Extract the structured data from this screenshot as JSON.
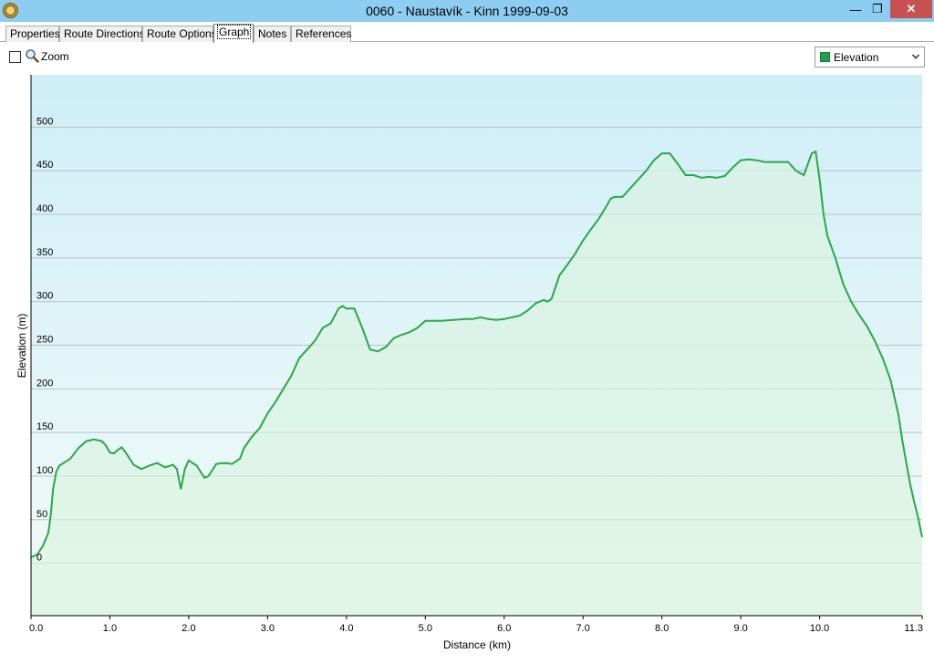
{
  "window": {
    "title": "0060 - Naustavík - Kinn 1999-09-03",
    "controls": {
      "minimize": "—",
      "maximize": "❐",
      "close": "✕"
    }
  },
  "tabs": [
    {
      "label": "Properties"
    },
    {
      "label": "Route Directions"
    },
    {
      "label": "Route Options"
    },
    {
      "label": "Graph",
      "active": true
    },
    {
      "label": "Notes"
    },
    {
      "label": "References"
    }
  ],
  "toolbar": {
    "zoom_label": "Zoom",
    "zoom_checked": false,
    "series_selector": {
      "selected": "Elevation",
      "swatch_color": "#1fa04a"
    }
  },
  "icons": {
    "app": "gps-app-icon",
    "zoom": "magnifier-icon",
    "dropdown": "chevron-down-icon"
  },
  "chart_data": {
    "type": "area",
    "xlabel": "Distance  (km)",
    "ylabel": "Elevation (m)",
    "xlim": [
      0,
      11.3
    ],
    "ylim": [
      -60,
      560
    ],
    "x_ticks": [
      "0.0",
      "1.0",
      "2.0",
      "3.0",
      "4.0",
      "5.0",
      "6.0",
      "7.0",
      "8.0",
      "9.0",
      "10.0",
      "11.3"
    ],
    "x_tick_values": [
      0,
      1,
      2,
      3,
      4,
      5,
      6,
      7,
      8,
      9,
      10,
      11.3
    ],
    "y_ticks": [
      "0",
      "50",
      "100",
      "150",
      "200",
      "250",
      "300",
      "350",
      "400",
      "450",
      "500"
    ],
    "y_tick_values": [
      0,
      50,
      100,
      150,
      200,
      250,
      300,
      350,
      400,
      450,
      500
    ],
    "grid": true,
    "line_color": "#2aa84a",
    "fill_color": "#d8f2e1",
    "background_top": "#cfeef8",
    "background_bottom": "#f3fbf7",
    "series": [
      {
        "x": [
          0,
          0.08,
          0.15,
          0.22,
          0.25,
          0.28,
          0.32,
          0.36,
          0.5,
          0.6,
          0.7,
          0.8,
          0.9,
          0.95,
          1.0,
          1.05,
          1.1,
          1.15,
          1.2,
          1.3,
          1.4,
          1.5,
          1.6,
          1.7,
          1.8,
          1.85,
          1.9,
          1.95,
          2.0,
          2.1,
          2.2,
          2.25,
          2.35,
          2.45,
          2.55,
          2.65,
          2.7,
          2.8,
          2.9,
          3.0,
          3.1,
          3.2,
          3.3,
          3.4,
          3.5,
          3.6,
          3.7,
          3.8,
          3.9,
          3.95,
          4.0,
          4.1,
          4.2,
          4.3,
          4.4,
          4.5,
          4.6,
          4.7,
          4.8,
          4.9,
          5.0,
          5.2,
          5.5,
          5.6,
          5.7,
          5.8,
          5.9,
          6.0,
          6.2,
          6.3,
          6.4,
          6.5,
          6.55,
          6.6,
          6.7,
          6.8,
          6.9,
          7.0,
          7.1,
          7.2,
          7.3,
          7.35,
          7.4,
          7.5,
          7.6,
          7.7,
          7.8,
          7.9,
          8.0,
          8.1,
          8.2,
          8.3,
          8.4,
          8.5,
          8.6,
          8.7,
          8.8,
          8.9,
          9.0,
          9.1,
          9.2,
          9.3,
          9.5,
          9.6,
          9.7,
          9.8,
          9.9,
          9.95,
          10.0,
          10.05,
          10.1,
          10.2,
          10.3,
          10.4,
          10.5,
          10.6,
          10.7,
          10.8,
          10.9,
          11.0,
          11.05,
          11.1,
          11.15,
          11.2,
          11.25,
          11.3
        ],
        "y": [
          7,
          10,
          20,
          35,
          55,
          85,
          105,
          112,
          120,
          132,
          140,
          142,
          140,
          135,
          127,
          126,
          130,
          133,
          127,
          113,
          108,
          112,
          115,
          110,
          113,
          108,
          85,
          108,
          118,
          112,
          98,
          100,
          114,
          115,
          114,
          120,
          132,
          145,
          155,
          172,
          185,
          200,
          215,
          235,
          245,
          255,
          270,
          275,
          292,
          295,
          292,
          292,
          270,
          245,
          243,
          248,
          258,
          262,
          265,
          270,
          278,
          278,
          280,
          280,
          282,
          280,
          279,
          280,
          284,
          290,
          298,
          302,
          300,
          303,
          330,
          342,
          355,
          370,
          383,
          395,
          410,
          418,
          420,
          420,
          430,
          440,
          450,
          462,
          470,
          470,
          458,
          445,
          445,
          442,
          443,
          442,
          444,
          454,
          462,
          463,
          462,
          460,
          460,
          460,
          450,
          445,
          470,
          472,
          440,
          400,
          375,
          350,
          320,
          300,
          285,
          272,
          255,
          235,
          210,
          170,
          140,
          115,
          90,
          70,
          52,
          30
        ]
      }
    ]
  }
}
